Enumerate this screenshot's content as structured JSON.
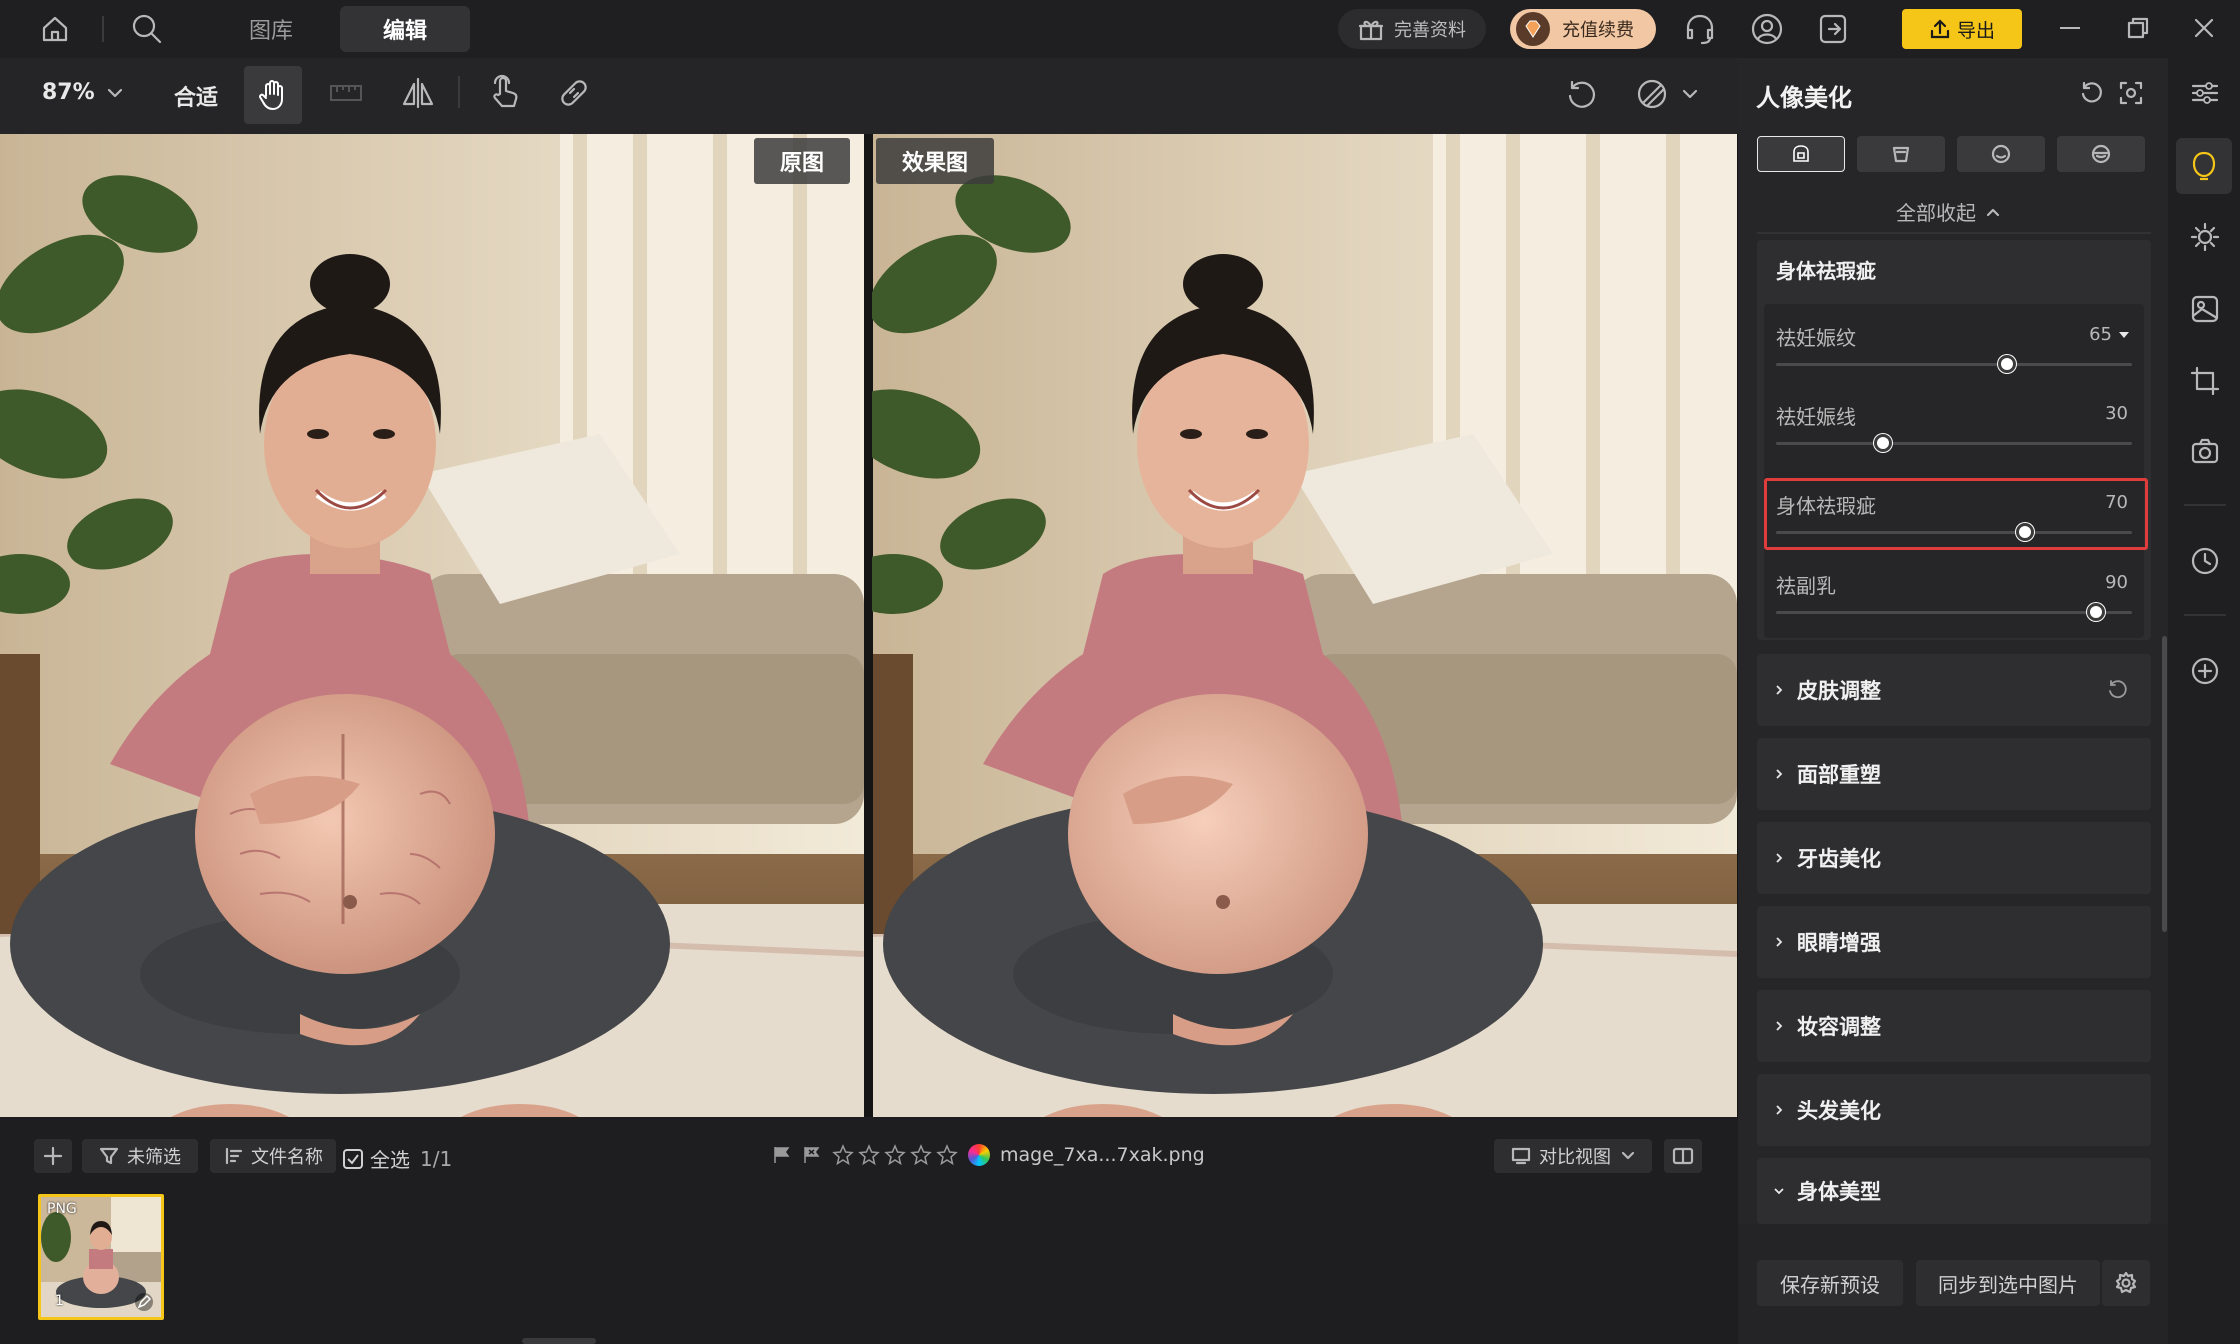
{
  "topbar": {
    "tabs": [
      {
        "label": "图库"
      },
      {
        "label": "编辑"
      }
    ],
    "complete_profile": "完善资料",
    "recharge": "充值续费",
    "export": "导出"
  },
  "toolbar": {
    "zoom": "87%",
    "fit": "合适"
  },
  "viewer": {
    "original_label": "原图",
    "result_label": "效果图"
  },
  "bottombar": {
    "filter": "未筛选",
    "sort": "文件名称",
    "select_all": "全选",
    "count": "1/1",
    "filename": "mage_7xa...7xak.png",
    "compare_view": "对比视图",
    "rating": 0
  },
  "filmstrip": {
    "items": [
      {
        "type": "PNG",
        "index": "1"
      }
    ]
  },
  "panel": {
    "title": "人像美化",
    "collapse_all": "全部收起",
    "body_section_title": "身体祛瑕疵",
    "sliders": [
      {
        "label": "祛妊娠纹",
        "value": "65",
        "fraction": 0.65
      },
      {
        "label": "祛妊娠线",
        "value": "30",
        "fraction": 0.3
      },
      {
        "label": "身体祛瑕疵",
        "value": "70",
        "fraction": 0.7
      },
      {
        "label": "祛副乳",
        "value": "90",
        "fraction": 0.9
      }
    ],
    "sections": [
      {
        "label": "皮肤调整"
      },
      {
        "label": "面部重塑"
      },
      {
        "label": "牙齿美化"
      },
      {
        "label": "眼睛增强"
      },
      {
        "label": "妆容调整"
      },
      {
        "label": "头发美化"
      },
      {
        "label": "身体美型"
      }
    ],
    "save_preset": "保存新预设",
    "sync": "同步到选中图片"
  },
  "colors": {
    "accent": "#f5c518",
    "highlight_border": "#e03c3c",
    "recharge_bg": "#f2c7a4"
  }
}
